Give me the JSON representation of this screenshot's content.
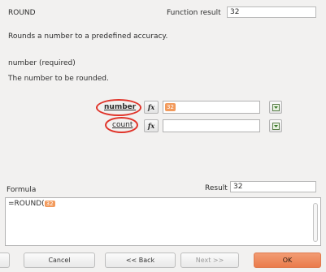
{
  "header": {
    "function_name": "ROUND",
    "function_result_label": "Function result",
    "function_result_value": "32"
  },
  "description": "Rounds a number to a predefined accuracy.",
  "parameter": {
    "name": "number (required)",
    "description": "The number to be rounded."
  },
  "args": [
    {
      "label": "number",
      "fx_label": "fx",
      "value_token": "32"
    },
    {
      "label": "count",
      "fx_label": "fx",
      "value_token": ""
    }
  ],
  "formula": {
    "label": "Formula",
    "prefix": "=ROUND(",
    "token": "32",
    "result_label": "Result",
    "result_value": "32"
  },
  "buttons": {
    "cancel": "Cancel",
    "back": "<< Back",
    "next": "Next >>",
    "ok": "OK"
  },
  "colors": {
    "highlight": "#e0342a",
    "token": "#f29a5c",
    "ok_button": "#ea7b4c"
  }
}
